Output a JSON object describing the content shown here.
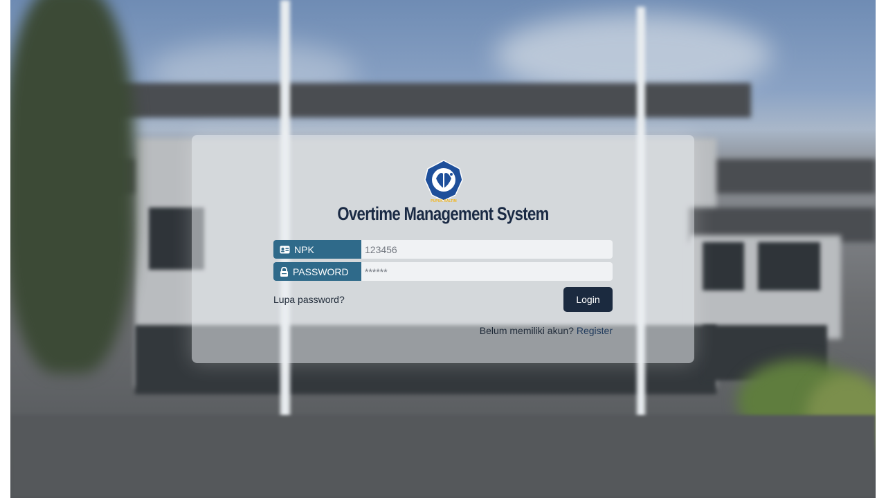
{
  "app": {
    "title": "Overtime Management System",
    "logo_text": "PUPUK KALTIM"
  },
  "form": {
    "npk": {
      "label": "NPK",
      "icon": "id-card-icon",
      "placeholder": "123456"
    },
    "password": {
      "label": "PASSWORD",
      "icon": "lock-icon",
      "placeholder": "******"
    },
    "forgot_label": "Lupa password?",
    "login_label": "Login",
    "register_prompt": "Belum memiliki akun?",
    "register_label": "Register"
  },
  "colors": {
    "primary_dark": "#1b2a3f",
    "label_bg": "#2f6a8a",
    "card_bg": "rgba(235,238,242,0.55)"
  }
}
